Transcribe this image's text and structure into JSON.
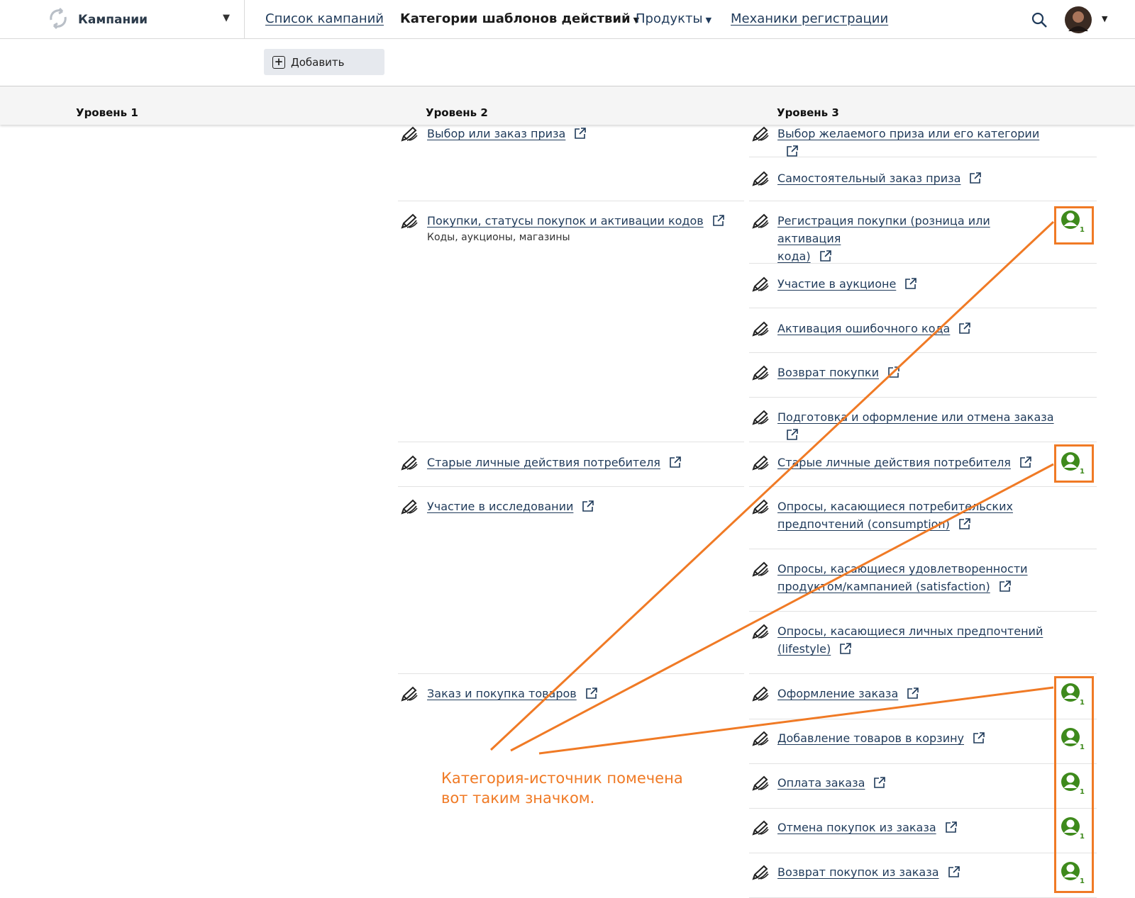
{
  "topbar": {
    "brand": "Кампании",
    "nav_campaigns": "Список кампаний",
    "nav_categories": "Категории шаблонов действий",
    "nav_products": "Продукты",
    "nav_mechanics": "Механики регистрации"
  },
  "toolbar": {
    "add_label": "Добавить"
  },
  "columns": {
    "level1": "Уровень 1",
    "level2": "Уровень 2",
    "level3": "Уровень 3"
  },
  "level2": [
    {
      "label": "Выбор или заказ приза"
    },
    {
      "label": "Покупки, статусы покупок и активации кодов",
      "sub": "Коды, аукционы, магазины"
    },
    {
      "label": "Старые личные действия потребителя"
    },
    {
      "label": "Участие в исследовании"
    },
    {
      "label": "Заказ и покупка товаров"
    }
  ],
  "level3": [
    {
      "line1": "Выбор желаемого приза или его категории",
      "line2": "",
      "source": false
    },
    {
      "line1": "Самостоятельный заказ приза",
      "line2": "",
      "source": false
    },
    {
      "line1": "Регистрация покупки (розница или активация",
      "line2": "кода)",
      "source": true,
      "count": "1"
    },
    {
      "line1": "Участие в аукционе",
      "line2": "",
      "source": false
    },
    {
      "line1": "Активация ошибочного кода",
      "line2": "",
      "source": false
    },
    {
      "line1": "Возврат покупки",
      "line2": "",
      "source": false
    },
    {
      "line1": "Подготовка и оформление или отмена заказа",
      "line2": "",
      "source": false
    },
    {
      "line1": "Старые личные действия потребителя",
      "line2": "",
      "source": true,
      "count": "1"
    },
    {
      "line1": "Опросы, касающиеся потребительских",
      "line2": "предпочтений (consumption)",
      "source": false
    },
    {
      "line1": "Опросы, касающиеся удовлетворенности",
      "line2": "продуктом/кампанией (satisfaction)",
      "source": false
    },
    {
      "line1": "Опросы, касающиеся личных предпочтений",
      "line2": "(lifestyle)",
      "source": false
    },
    {
      "line1": "Оформление заказа",
      "line2": "",
      "source": true,
      "count": "1"
    },
    {
      "line1": "Добавление товаров в корзину",
      "line2": "",
      "source": true,
      "count": "1"
    },
    {
      "line1": "Оплата заказа",
      "line2": "",
      "source": true,
      "count": "1"
    },
    {
      "line1": "Отмена покупок из заказа",
      "line2": "",
      "source": true,
      "count": "1"
    },
    {
      "line1": "Возврат покупок из заказа",
      "line2": "",
      "source": true,
      "count": "1"
    }
  ],
  "annotation": {
    "text_line1": "Категория-источник помечена",
    "text_line2": "вот таким значком."
  },
  "colors": {
    "accent": "#f07a25",
    "source_icon": "#3e8a1c",
    "link": "#1f3a5a"
  }
}
